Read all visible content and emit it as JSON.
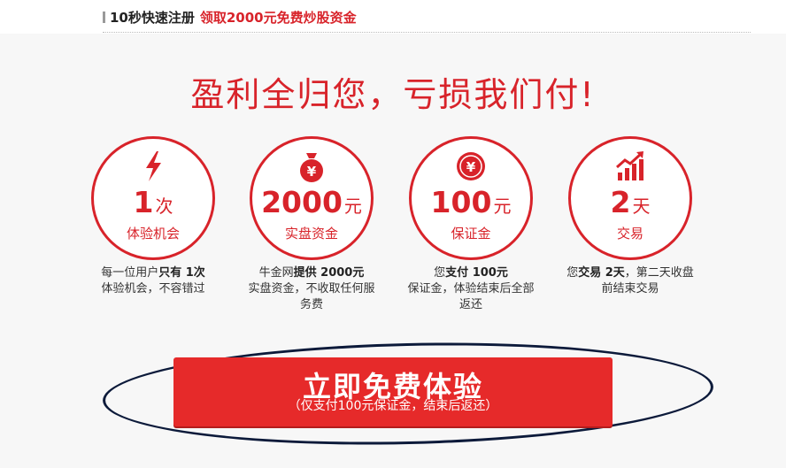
{
  "topbar": {
    "lead": "10秒快速注册",
    "highlight": "领取2000元免费炒股资金"
  },
  "headline": "盈利全归您，亏损我们付!",
  "features": [
    {
      "icon": "lightning-icon",
      "number": "1",
      "unit": "次",
      "label": "体验机会",
      "desc": [
        "每一位用户",
        "只有 1次",
        "体验机会，不容错过"
      ]
    },
    {
      "icon": "money-bag-icon",
      "number": "2000",
      "unit": "元",
      "label": "实盘资金",
      "desc": [
        "牛金网",
        "提供 2000元",
        "实盘资金，不收取任何服务费"
      ]
    },
    {
      "icon": "yuan-coin-icon",
      "number": "100",
      "unit": "元",
      "label": "保证金",
      "desc": [
        "您",
        "支付 100元",
        "保证金，体验结束后全部返还"
      ]
    },
    {
      "icon": "growth-chart-icon",
      "number": "2",
      "unit": "天",
      "label": "交易",
      "desc": [
        "您",
        "交易 2天",
        "，第二天收盘前结束交易"
      ]
    }
  ],
  "cta": {
    "main": "立即免费体验",
    "sub": "（仅支付100元保证金，结束后返还）"
  },
  "colors": {
    "accent": "#d8232a",
    "button": "#e62a2a",
    "oval": "#0c1a3a"
  }
}
